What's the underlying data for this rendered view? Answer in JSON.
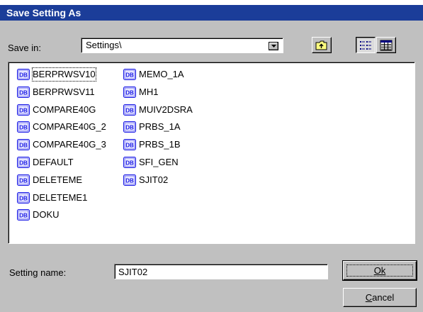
{
  "dialog": {
    "title": "Save Setting As"
  },
  "save_in": {
    "label": "Save in:",
    "value": "Settings\\"
  },
  "toolbar": {
    "up_folder_icon": "up-folder-icon",
    "list_view_icon": "list-view-icon",
    "details_view_icon": "details-view-icon"
  },
  "files": {
    "icon": "DB",
    "col1": [
      "BERPRWSV10",
      "BERPRWSV11",
      "COMPARE40G",
      "COMPARE40G_2",
      "COMPARE40G_3",
      "DEFAULT",
      "DELETEME",
      "DELETEME1",
      "DOKU"
    ],
    "col2": [
      "MEMO_1A",
      "MH1",
      "MUIV2DSRA",
      "PRBS_1A",
      "PRBS_1B",
      "SFI_GEN",
      "SJIT02"
    ]
  },
  "setting_name": {
    "label": "Setting name:",
    "value": "SJIT02"
  },
  "buttons": {
    "ok": "Ok",
    "cancel": "Cancel"
  },
  "colors": {
    "titlebar": "#1b3d99",
    "face": "#c0c0c0",
    "icon_blue": "#1a1ae6"
  }
}
